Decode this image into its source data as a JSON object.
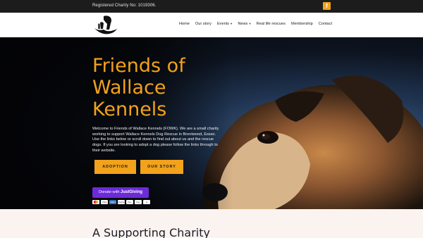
{
  "topbar": {
    "charity_text": "Registered Charity No: 1019306.",
    "facebook_glyph": "f",
    "accent": "#f2a21b"
  },
  "nav": {
    "items": [
      {
        "label": "Home",
        "dropdown": false
      },
      {
        "label": "Our story",
        "dropdown": false
      },
      {
        "label": "Events",
        "dropdown": true
      },
      {
        "label": "News",
        "dropdown": true
      },
      {
        "label": "Real life rescues",
        "dropdown": false
      },
      {
        "label": "Membership",
        "dropdown": false
      },
      {
        "label": "Contact",
        "dropdown": false
      }
    ]
  },
  "hero": {
    "title": "Friends of Wallace Kennels",
    "intro": "Welcome to Friends of Wallace Kennels (FOWK). We are a small charity working to support Wallace Kennels Dog Rescue in Brentwood, Essex. Use the links below or scroll down to find out about us and the rescue dogs. If you are looking to adopt a dog please follow the links through to their website.",
    "buttons": {
      "adoption": "ADOPTION",
      "our_story": "OUR STORY"
    },
    "donate": {
      "prefix": "Donate with",
      "brand": "JustGiving"
    },
    "payment_methods": [
      "mastercard",
      "VISA",
      "AMEX",
      "PayPal",
      "Pay",
      "Pay",
      "G"
    ]
  },
  "section": {
    "heading": "A Supporting Charity"
  }
}
